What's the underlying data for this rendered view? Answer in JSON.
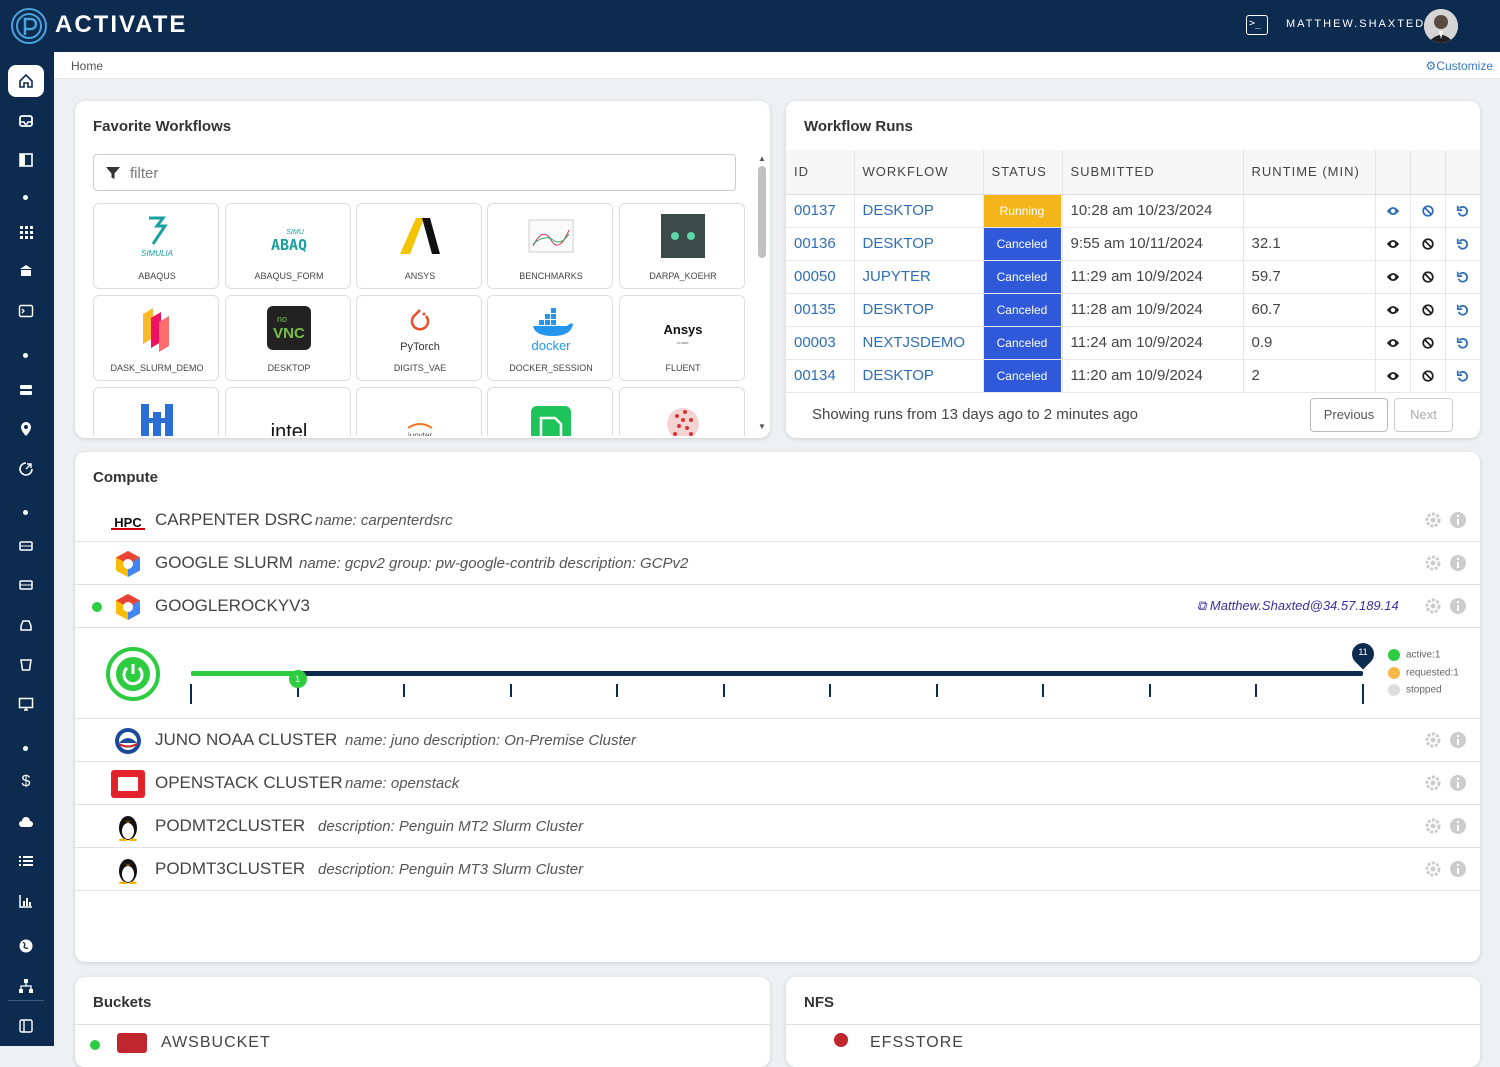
{
  "app": {
    "brand": "ACTIVATE",
    "username": "MATTHEW.SHAXTED"
  },
  "subbar": {
    "breadcrumb": "Home",
    "customize": "Customize"
  },
  "sidebar": {
    "items": [
      "home-icon",
      "inbox-icon",
      "panel-icon",
      "apps-grid-icon",
      "bank-icon",
      "terminal-icon",
      "storage-icon",
      "location-pin-icon",
      "cpu-icon",
      "drive-icon",
      "drive-icon",
      "disk-icon",
      "bucket-icon",
      "monitor-icon",
      "dollar-icon",
      "cloud-icon",
      "list-icon",
      "bar-chart-icon",
      "globe-icon",
      "org-chart-icon",
      "collapse-icon"
    ]
  },
  "favorites": {
    "title": "Favorite Workflows",
    "filter_placeholder": "filter",
    "tiles": [
      {
        "label": "ABAQUS"
      },
      {
        "label": "ABAQUS_FORM"
      },
      {
        "label": "ANSYS"
      },
      {
        "label": "BENCHMARKS"
      },
      {
        "label": "DARPA_KOEHR"
      },
      {
        "label": "DASK_SLURM_DEMO"
      },
      {
        "label": "DESKTOP"
      },
      {
        "label": "DIGITS_VAE"
      },
      {
        "label": "DOCKER_SESSION"
      },
      {
        "label": "FLUENT"
      },
      {
        "label": ""
      },
      {
        "label": ""
      },
      {
        "label": ""
      },
      {
        "label": ""
      },
      {
        "label": ""
      }
    ],
    "logo_text": {
      "abaqus_1": "SIMULIA",
      "abaqus_form_1": "SIMU",
      "abaqus_form_2": "ABAQ",
      "novnc_1": "no",
      "novnc_2": "VNC",
      "pytorch": "PyTorch",
      "docker": "docker",
      "ansys_fluent_1": "Ansys",
      "ansys_fluent_2": "FLUENT",
      "intel": "intel",
      "jupyter": "jupyter"
    }
  },
  "runs": {
    "title": "Workflow Runs",
    "columns": [
      "ID",
      "WORKFLOW",
      "STATUS",
      "SUBMITTED",
      "RUNTIME (MIN)"
    ],
    "rows": [
      {
        "id": "00137",
        "workflow": "DESKTOP",
        "status": "Running",
        "submitted": "10:28 am 10/23/2024",
        "runtime": ""
      },
      {
        "id": "00136",
        "workflow": "DESKTOP",
        "status": "Canceled",
        "submitted": "9:55 am 10/11/2024",
        "runtime": "32.1"
      },
      {
        "id": "00050",
        "workflow": "JUPYTER",
        "status": "Canceled",
        "submitted": "11:29 am 10/9/2024",
        "runtime": "59.7"
      },
      {
        "id": "00135",
        "workflow": "DESKTOP",
        "status": "Canceled",
        "submitted": "11:28 am 10/9/2024",
        "runtime": "60.7"
      },
      {
        "id": "00003",
        "workflow": "NEXTJSDEMO",
        "status": "Canceled",
        "submitted": "11:24 am 10/9/2024",
        "runtime": "0.9"
      },
      {
        "id": "00134",
        "workflow": "DESKTOP",
        "status": "Canceled",
        "submitted": "11:20 am 10/9/2024",
        "runtime": "2"
      }
    ],
    "footer": "Showing runs from 13 days ago to 2 minutes ago",
    "prev": "Previous",
    "next": "Next",
    "colors": {
      "running": "#f3b519",
      "canceled": "#2f59d8"
    }
  },
  "compute": {
    "title": "Compute",
    "clusters": [
      {
        "name": "CARPENTER DSRC",
        "desc": "name: carpenterdsrc",
        "icon": "hpc-icon"
      },
      {
        "name": "GOOGLE SLURM",
        "desc": "name: gcpv2 group: pw-google-contrib description: GCPv2",
        "icon": "google-cloud-icon"
      },
      {
        "name": "GOOGLEROCKYV3",
        "desc": "",
        "icon": "google-cloud-icon",
        "user": "Matthew.Shaxted@34.57.189.14"
      },
      {
        "name": "JUNO NOAA CLUSTER",
        "desc": "name: juno description: On-Premise Cluster",
        "icon": "noaa-icon"
      },
      {
        "name": "OPENSTACK CLUSTER",
        "desc": "name: openstack",
        "icon": "openstack-icon"
      },
      {
        "name": "PODMT2CLUSTER",
        "desc": "description: Penguin MT2 Slurm Cluster",
        "icon": "penguin-icon"
      },
      {
        "name": "PODMT3CLUSTER",
        "desc": "description: Penguin MT3 Slurm Cluster",
        "icon": "penguin-icon"
      }
    ],
    "nodes": {
      "active": 1,
      "max": 11,
      "active_label": "1",
      "max_label": "11",
      "legend": [
        "active:1",
        "requested:1",
        "stopped"
      ]
    }
  },
  "buckets": {
    "title": "Buckets",
    "first": "AWSBUCKET"
  },
  "nfs": {
    "title": "NFS",
    "first": "EFSSTORE"
  }
}
